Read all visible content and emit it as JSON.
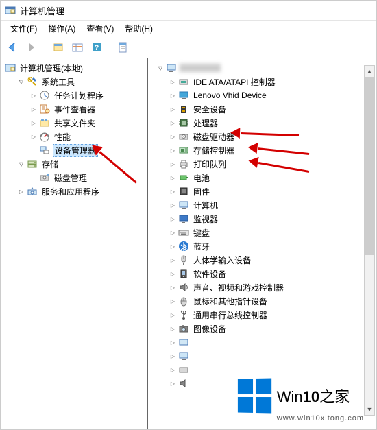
{
  "title": "计算机管理",
  "menu": {
    "file": "文件(F)",
    "action": "操作(A)",
    "view": "查看(V)",
    "help": "帮助(H)"
  },
  "left_tree": {
    "root": "计算机管理(本地)",
    "system_tools": "系统工具",
    "task_scheduler": "任务计划程序",
    "event_viewer": "事件查看器",
    "shared_folders": "共享文件夹",
    "performance": "性能",
    "device_manager": "设备管理器",
    "storage": "存储",
    "disk_management": "磁盘管理",
    "services_apps": "服务和应用程序"
  },
  "right_tree": {
    "ide": "IDE ATA/ATAPI 控制器",
    "lenovo": "Lenovo Vhid Device",
    "security": "安全设备",
    "processor": "处理器",
    "disk_drives": "磁盘驱动器",
    "storage_ctl": "存储控制器",
    "print_queue": "打印队列",
    "battery": "电池",
    "firmware": "固件",
    "computer": "计算机",
    "monitor": "监视器",
    "keyboard": "键盘",
    "bluetooth": "蓝牙",
    "hid": "人体学输入设备",
    "software": "软件设备",
    "sound": "声音、视频和游戏控制器",
    "mouse": "鼠标和其他指针设备",
    "usb": "通用串行总线控制器",
    "imaging": "图像设备"
  },
  "watermark": {
    "brand_pre": "Win",
    "brand_bold": "10",
    "brand_suf": "之家",
    "url": "www.win10xitong.com"
  }
}
